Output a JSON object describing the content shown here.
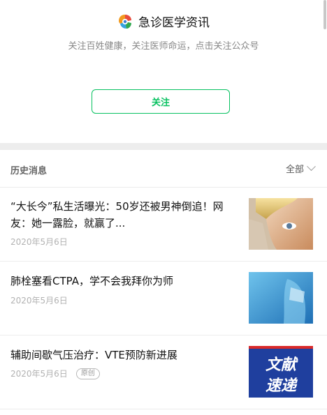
{
  "account": {
    "name": "急诊医学资讯",
    "tagline": "关注百姓健康，关注医师命运，点击关注公众号",
    "follow_label": "关注"
  },
  "history": {
    "title": "历史消息",
    "filter_label": "全部"
  },
  "articles": [
    {
      "title": "“大长今”私生活曝光：50岁还被男神倒追！网友：她一露脸，就赢了...",
      "date": "2020年5月6日",
      "badge": ""
    },
    {
      "title": "肺栓塞看CTPA，学不会我拜你为师",
      "date": "2020年5月6日",
      "badge": ""
    },
    {
      "title": "辅助间歇气压治疗：VTE预防新进展",
      "date": "2020年5月6日",
      "badge": "原创",
      "thumb_text_1": "文献",
      "thumb_text_2": "速递"
    }
  ],
  "colors": {
    "accent": "#07c160",
    "divider": "#ededed"
  }
}
